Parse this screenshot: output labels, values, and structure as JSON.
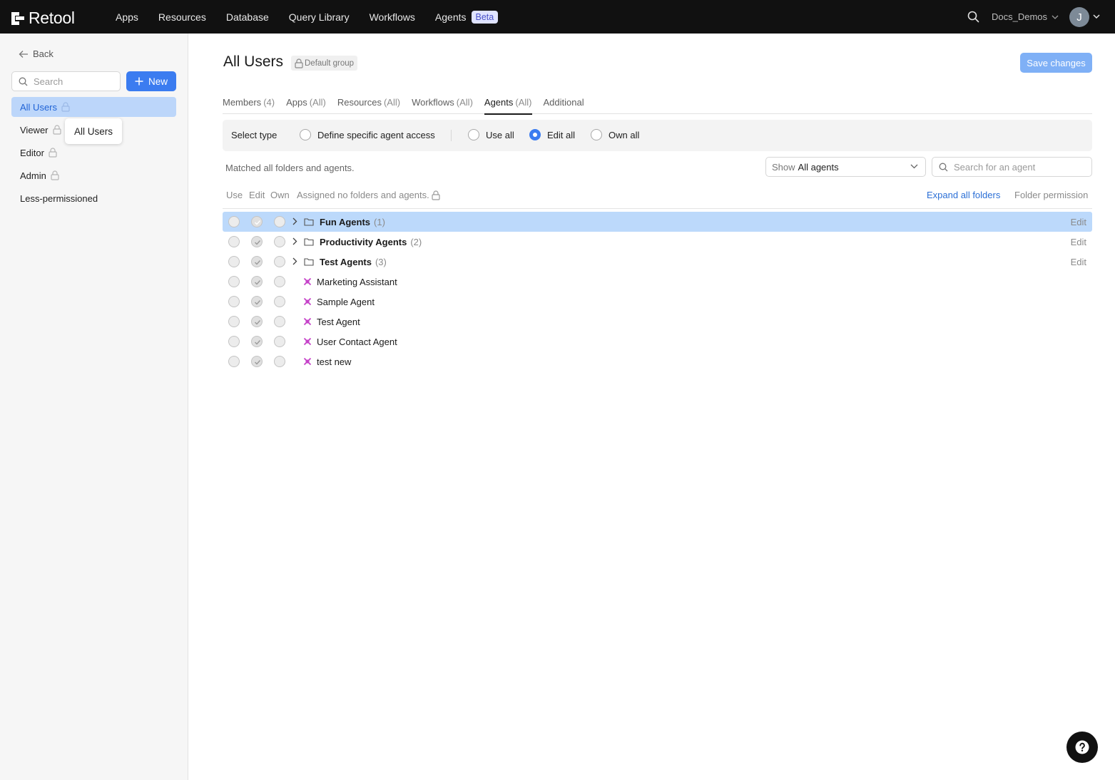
{
  "topnav": {
    "brand": "Retool",
    "items": [
      "Apps",
      "Resources",
      "Database",
      "Query Library",
      "Workflows",
      "Agents"
    ],
    "beta_badge": "Beta",
    "org_name": "Docs_Demos",
    "avatar_initial": "J"
  },
  "sidebar": {
    "back_label": "Back",
    "search_placeholder": "Search",
    "new_button": "New",
    "groups": [
      {
        "label": "All Users",
        "locked": true,
        "active": true
      },
      {
        "label": "Viewer",
        "locked": true
      },
      {
        "label": "Editor",
        "locked": true
      },
      {
        "label": "Admin",
        "locked": true
      },
      {
        "label": "Less-permissioned",
        "locked": false
      }
    ],
    "tooltip": "All Users"
  },
  "main": {
    "title": "All Users",
    "default_badge": "Default group",
    "save_button": "Save changes",
    "tabs": [
      {
        "label": "Members",
        "count": "(4)"
      },
      {
        "label": "Apps",
        "count": "(All)"
      },
      {
        "label": "Resources",
        "count": "(All)"
      },
      {
        "label": "Workflows",
        "count": "(All)"
      },
      {
        "label": "Agents",
        "count": "(All)",
        "active": true
      },
      {
        "label": "Additional",
        "count": ""
      }
    ],
    "select_type": {
      "label": "Select type",
      "options": [
        "Define specific agent access",
        "Use all",
        "Edit all",
        "Own all"
      ],
      "selected": "Edit all"
    },
    "matched_text": "Matched all folders and agents.",
    "show_filter": {
      "prefix": "Show",
      "value": "All agents"
    },
    "agent_search_placeholder": "Search for an agent",
    "columns": {
      "use": "Use",
      "edit": "Edit",
      "own": "Own"
    },
    "assigned_text": "Assigned no folders and agents.",
    "expand_all": "Expand all folders",
    "folder_permission": "Folder permission",
    "folders": [
      {
        "name": "Fun Agents",
        "count": "(1)",
        "action": "Edit",
        "highlight": true
      },
      {
        "name": "Productivity Agents",
        "count": "(2)",
        "action": "Edit"
      },
      {
        "name": "Test Agents",
        "count": "(3)",
        "action": "Edit"
      }
    ],
    "agents": [
      "Marketing Assistant",
      "Sample Agent",
      "Test Agent",
      "User Contact Agent",
      "test new"
    ]
  },
  "colors": {
    "accent": "#3b7cf0",
    "highlight": "#bcd9fb",
    "agent_icon": "#c542c8"
  }
}
